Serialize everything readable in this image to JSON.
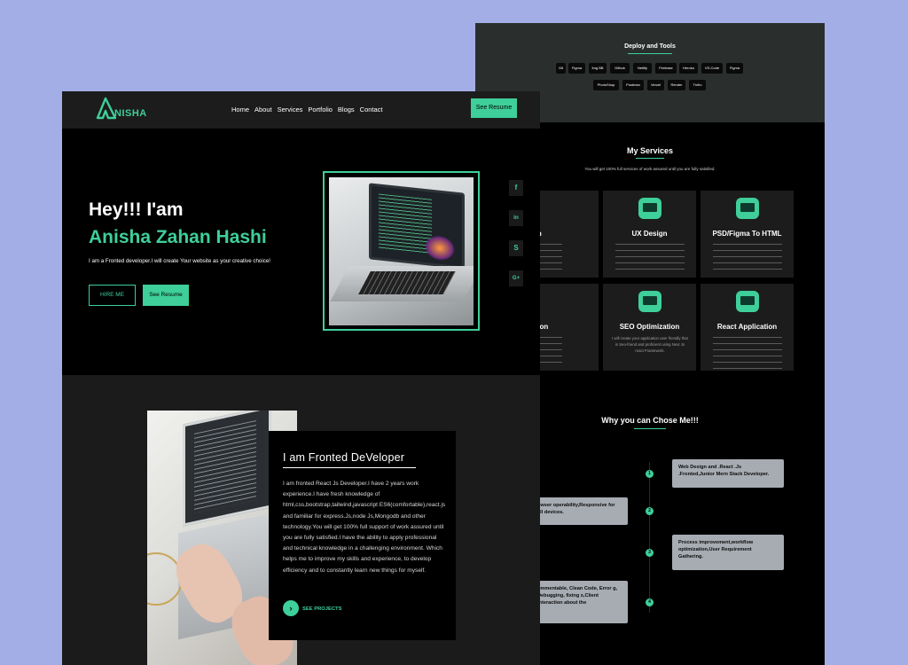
{
  "deploy": {
    "title": "Deploy and Tools",
    "tools": [
      "Git",
      "Figma",
      "Img BB",
      "Github",
      "Netlify",
      "Firebase",
      "Heroku",
      "VS-Code",
      "Figma",
      "PhotoShop",
      "Postman",
      "Vercel",
      "Render",
      "Trello"
    ]
  },
  "services": {
    "title": "My Services",
    "subtitle": "You will get 100% full services of work assured until you are fully satisfied.",
    "cards": [
      {
        "title": "nsive design"
      },
      {
        "title": "UX Design"
      },
      {
        "title": "PSD/Figma To HTML"
      },
      {
        "title": "Application"
      },
      {
        "title": "SEO Optimization"
      },
      {
        "title": "React Application"
      }
    ],
    "seo_desc": "I will create your application user friendly that is Seo-friend and proficient using Next Js react Framework."
  },
  "why": {
    "title": "Why you can Chose Me!!!",
    "items": [
      {
        "num": "1",
        "text": "Web Design and .React .Js .Fronted,Junior Mern Stack Developer."
      },
      {
        "num": "2",
        "text": "owser operability,Responsive for all devices."
      },
      {
        "num": "3",
        "text": "Process improvement,workflow optimization,User Requirement Gathering."
      },
      {
        "num": "4",
        "text": "ommentable, Clean Code, Error g, Debugging, fixing s,Client Interaction about the"
      }
    ]
  },
  "nav": {
    "logo": "NISHA",
    "links": [
      "Home",
      "About",
      "Services",
      "Portfolio",
      "Blogs",
      "Contact"
    ],
    "resume": "See Resume"
  },
  "hero": {
    "greeting": "Hey!!! I'am",
    "name": "Anisha Zahan Hashi",
    "description": "I am a Fronted developer.I will create Your website as your creative choice!",
    "hire": "HIRE ME",
    "resume": "See Resume"
  },
  "social": [
    "f",
    "in",
    "S",
    "G+"
  ],
  "about": {
    "title": "I am Fronted DeVeloper",
    "text": "I am fronted React Js Developer.I have 2 years work experience.I have fresh knowledge of html,css,bootstrap,tailwind,javascript ES6(comfortable),react.js and familiar for express.Js,node Js,Mongodb and other technology.You will get 100% full support of work assured until you are fully satisfied.I have the ability to apply professional and technical knowledge in a challenging environment. Which helps me to improve my skills and experience, to develop efficiency and to constantly learn new things for myself.",
    "projects": "SEE PROJECTS",
    "projects_icon": "›"
  },
  "colors": {
    "accent": "#3ecf9a",
    "background": "#a4aee6"
  }
}
